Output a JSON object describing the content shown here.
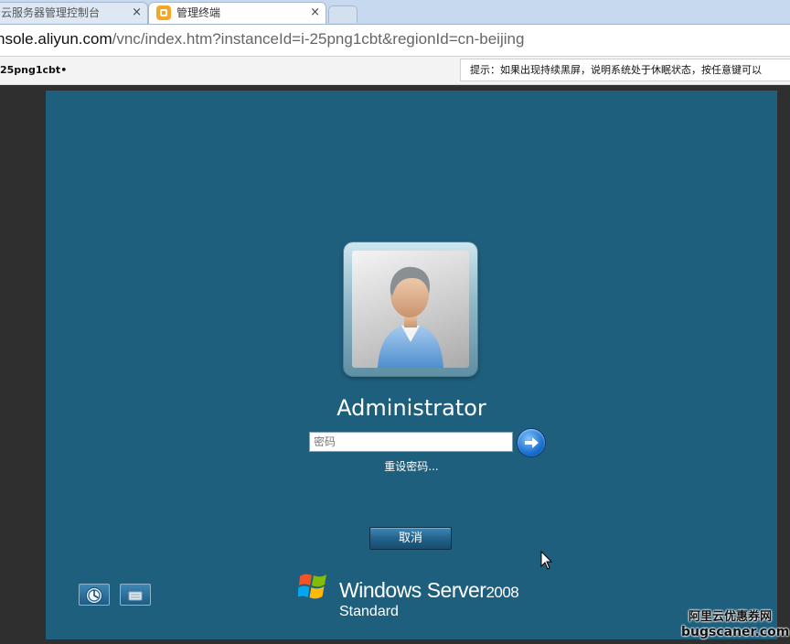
{
  "browser": {
    "tabs": [
      {
        "label": "云服务器管理控制台",
        "active": false
      },
      {
        "label": "管理终端",
        "active": true
      }
    ],
    "close_symbol": "×",
    "url": {
      "host": "nsole.aliyun.com",
      "path": "/vnc/index.htm?instanceId=i-25png1cbt&regionId=cn-beijing"
    }
  },
  "infobar": {
    "instance": "25png1cbt",
    "instance_suffix": "•",
    "tip": "提示：如果出现持续黑屏，说明系统处于休眠状态，按任意键可以"
  },
  "login": {
    "username": "Administrator",
    "password_placeholder": "密码",
    "reset_password": "重设密码...",
    "cancel": "取消"
  },
  "brand": {
    "name": "Windows Server",
    "version": "2008",
    "edition": "Standard"
  },
  "watermark": {
    "line1": "阿里云优惠券网",
    "line2": "bugscaner.com"
  },
  "icons": {
    "tab_favicon": "aliyun-icon",
    "go": "arrow-right-icon",
    "ease_of_access": "ease-of-access-icon",
    "keyboard": "keyboard-icon",
    "logo": "windows-logo-icon"
  },
  "colors": {
    "desktop_bg": "#1f5f7e",
    "tab_strip": "#c7d9ee",
    "accent_button": "#205f88"
  }
}
